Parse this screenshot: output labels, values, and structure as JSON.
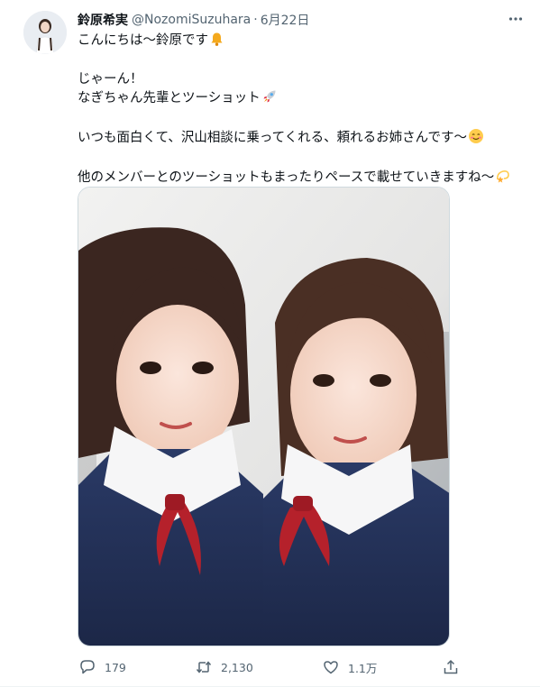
{
  "tweet": {
    "display_name": "鈴原希実",
    "handle": "@NozomiSuzuhara",
    "separator": "·",
    "date": "6月22日",
    "lines": [
      "こんにちは〜鈴原です",
      "じゃーん！",
      "なぎちゃん先輩とツーショット",
      "いつも面白くて、沢山相談に乗ってくれる、頼れるお姉さんです〜",
      "他のメンバーとのツーショットもまったりペースで載せていきますね〜"
    ],
    "emoji": [
      "bell-icon",
      "rocket-icon",
      "smiling-face-icon",
      "dizzy-star-icon"
    ],
    "media": {
      "description_icon": "photo-two-students-in-navy-blazers"
    }
  },
  "actions": {
    "reply_count": "179",
    "retweet_count": "2,130",
    "like_count": "1.1万"
  },
  "colors": {
    "text": "#0f1419",
    "secondary": "#536471",
    "border": "#cfd9de"
  }
}
